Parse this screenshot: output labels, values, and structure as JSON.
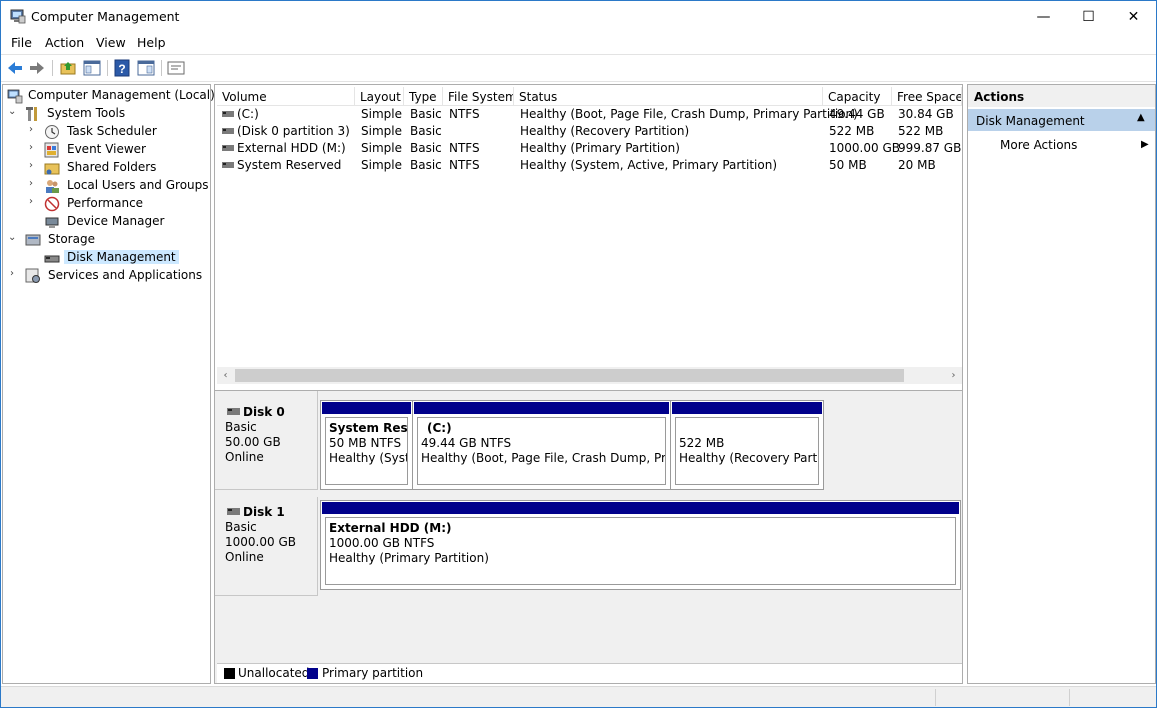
{
  "window": {
    "title": "Computer Management",
    "minimize": "—",
    "maximize": "☐",
    "close": "✕"
  },
  "menu": [
    "File",
    "Action",
    "View",
    "Help"
  ],
  "tree": {
    "root": "Computer Management (Local)",
    "items": [
      {
        "label": "System Tools",
        "icon": "tools-icon"
      },
      {
        "label": "Task Scheduler",
        "icon": "clock-icon"
      },
      {
        "label": "Event Viewer",
        "icon": "event-viewer-icon"
      },
      {
        "label": "Shared Folders",
        "icon": "shared-folders-icon"
      },
      {
        "label": "Local Users and Groups",
        "icon": "users-icon"
      },
      {
        "label": "Performance",
        "icon": "performance-icon"
      },
      {
        "label": "Device Manager",
        "icon": "device-manager-icon"
      },
      {
        "label": "Storage",
        "icon": "storage-icon"
      },
      {
        "label": "Disk Management",
        "icon": "disk-icon"
      },
      {
        "label": "Services and Applications",
        "icon": "services-icon"
      }
    ]
  },
  "volumes": {
    "columns": [
      "Volume",
      "Layout",
      "Type",
      "File System",
      "Status",
      "Capacity",
      "Free Space"
    ],
    "rows": [
      {
        "volume": "(C:)",
        "layout": "Simple",
        "type": "Basic",
        "fs": "NTFS",
        "status": "Healthy (Boot, Page File, Crash Dump, Primary Partition)",
        "capacity": "49.44 GB",
        "free": "30.84 GB"
      },
      {
        "volume": "(Disk 0 partition 3)",
        "layout": "Simple",
        "type": "Basic",
        "fs": "",
        "status": "Healthy (Recovery Partition)",
        "capacity": "522 MB",
        "free": "522 MB"
      },
      {
        "volume": "External HDD (M:)",
        "layout": "Simple",
        "type": "Basic",
        "fs": "NTFS",
        "status": "Healthy (Primary Partition)",
        "capacity": "1000.00 GB",
        "free": "999.87 GB"
      },
      {
        "volume": "System Reserved",
        "layout": "Simple",
        "type": "Basic",
        "fs": "NTFS",
        "status": "Healthy (System, Active, Primary Partition)",
        "capacity": "50 MB",
        "free": "20 MB"
      }
    ]
  },
  "disks": [
    {
      "name": "Disk 0",
      "type": "Basic",
      "size": "50.00 GB",
      "state": "Online",
      "partitions": [
        {
          "name": "System Reser",
          "size": "50 MB NTFS",
          "status": "Healthy (Syster"
        },
        {
          "name": "(C:)",
          "size": "49.44 GB NTFS",
          "status": "Healthy (Boot, Page File, Crash Dump, Primar"
        },
        {
          "name": "",
          "size": "522 MB",
          "status": "Healthy (Recovery Partitic"
        }
      ]
    },
    {
      "name": "Disk 1",
      "type": "Basic",
      "size": "1000.00 GB",
      "state": "Online",
      "partitions": [
        {
          "name": "External HDD  (M:)",
          "size": "1000.00 GB NTFS",
          "status": "Healthy (Primary Partition)"
        }
      ]
    }
  ],
  "legend": {
    "unallocated": "Unallocated",
    "primary": "Primary partition",
    "unallocated_color": "#000000",
    "primary_color": "#00008b"
  },
  "actions": {
    "title": "Actions",
    "section": "Disk Management",
    "more": "More Actions"
  },
  "colors": {
    "selection": "#cce8ff",
    "actions_section": "#b9d1ea",
    "partition_header": "#00008b"
  }
}
